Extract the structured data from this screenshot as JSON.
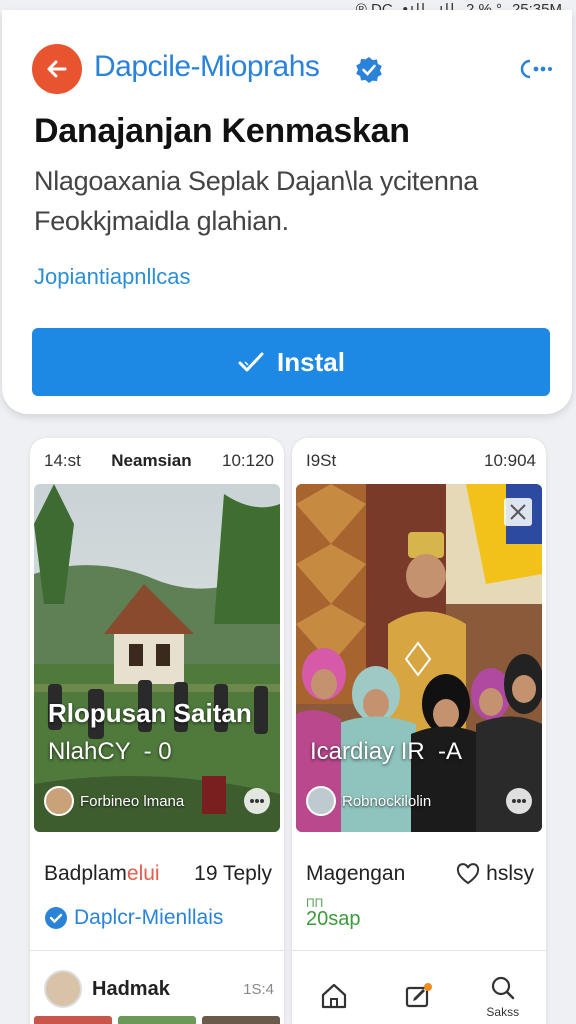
{
  "status_bar": {
    "left_text": "® DC",
    "signal_text": "•ıll .ıll",
    "battery_text": "2 % °",
    "time": "25:35M"
  },
  "header": {
    "app_name": "Dapcile-Mioprahs",
    "title": "Danajanjan Kenmaskan",
    "description_line1": "Nlagoaxania Seplak Dajan\\la ycitenna",
    "description_line2": "Feokkjmaidla glahian.",
    "app_link": "Jopiantiapnllcas",
    "install_label": "Instal"
  },
  "cards": [
    {
      "head_left": "14:st",
      "head_mid": "Neamsian",
      "head_right": "10:120",
      "overlay_title": "Rlopusan Saitan",
      "overlay_sub": "NlahCY  - 0",
      "author": "Forbineo lmana",
      "meta_left": "Badplam",
      "meta_left_accent": "elui",
      "meta_right": "19 Teply",
      "link_label": "Daplcr-Mienllais",
      "comment_name": "Hadmak",
      "comment_time": "1S:4"
    },
    {
      "head_left": "I9St",
      "head_right": "10:904",
      "overlay_sub": "Icardiay IR  -A",
      "author": "Robnockilolin",
      "meta_left": "Magengan",
      "meta_right": "hslsy",
      "mini_label": "ПП",
      "green_label": "20sap",
      "tab_search_label": "Sakss"
    }
  ],
  "colors": {
    "accent_blue": "#1e88e5",
    "back_button": "#e8542f",
    "link_blue": "#2a83d8"
  }
}
